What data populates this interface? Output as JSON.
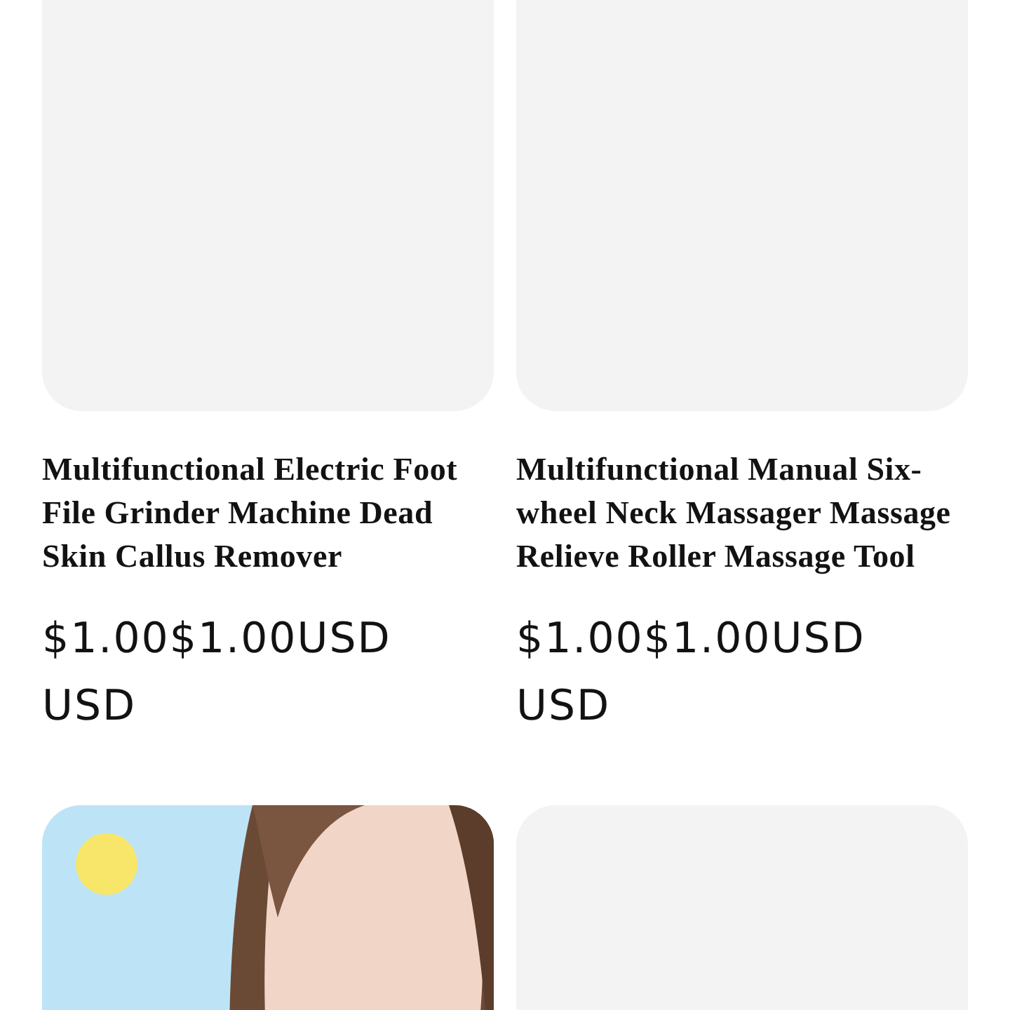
{
  "products": [
    {
      "image": {
        "kind": "blank"
      },
      "title": "Multifunctional Electric Foot File Grinder Machine Dead Skin Callus Remover",
      "price": "$1.00$1.00USD USD"
    },
    {
      "image": {
        "kind": "blank"
      },
      "title": "Multifunctional Manual Six-wheel Neck Massager Massage Relieve Roller Massage Tool",
      "price": "$1.00$1.00USD USD"
    },
    {
      "image": {
        "kind": "picture"
      }
    },
    {
      "image": {
        "kind": "blank"
      }
    }
  ]
}
